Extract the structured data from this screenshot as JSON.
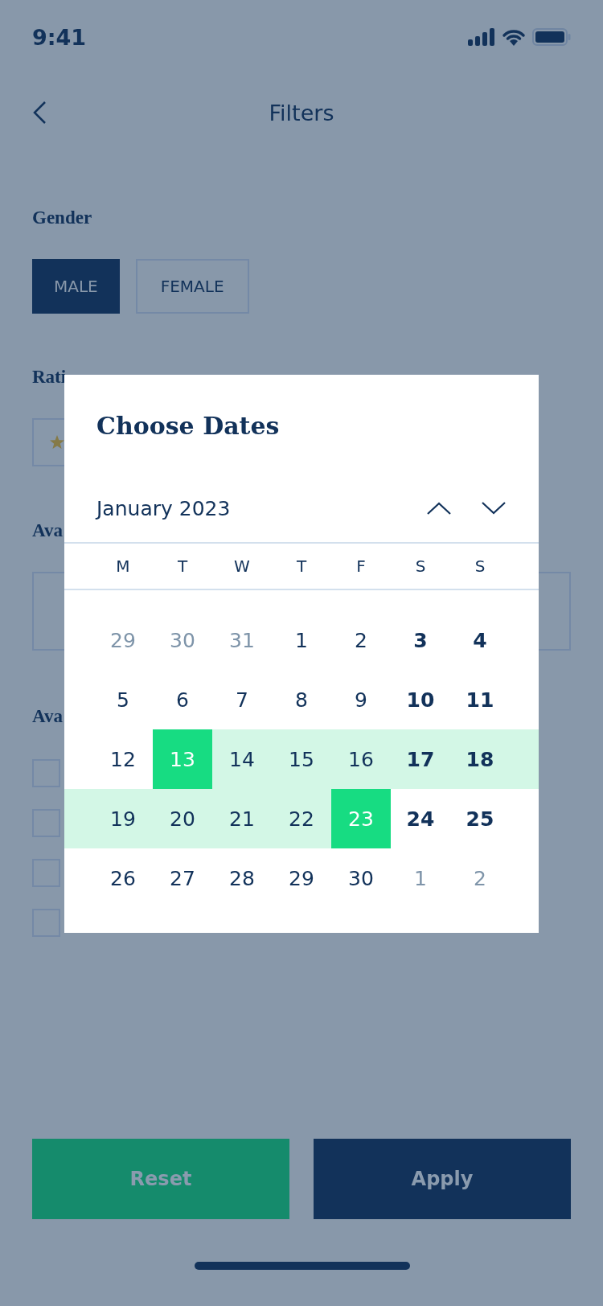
{
  "status_bar": {
    "time": "9:41"
  },
  "header": {
    "title": "Filters"
  },
  "gender": {
    "label": "Gender",
    "options": [
      {
        "label": "MALE",
        "selected": true
      },
      {
        "label": "FEMALE",
        "selected": false
      }
    ]
  },
  "rating": {
    "label": "Rati"
  },
  "availability_dates": {
    "label": "Ava"
  },
  "availability_times": {
    "label": "Ava",
    "checkboxes": [
      {
        "checked": false
      },
      {
        "checked": false
      },
      {
        "checked": false
      },
      {
        "checked": false
      }
    ]
  },
  "date_picker": {
    "title": "Choose Dates",
    "month": "January 2023",
    "weekdays": [
      "M",
      "T",
      "W",
      "T",
      "F",
      "S",
      "S"
    ],
    "weeks": [
      [
        {
          "label": "29",
          "kind": "outside",
          "selected": false,
          "in_range": false
        },
        {
          "label": "30",
          "kind": "outside",
          "selected": false,
          "in_range": false
        },
        {
          "label": "31",
          "kind": "outside",
          "selected": false,
          "in_range": false
        },
        {
          "label": "1",
          "kind": "day",
          "selected": false,
          "in_range": false
        },
        {
          "label": "2",
          "kind": "day",
          "selected": false,
          "in_range": false
        },
        {
          "label": "3",
          "kind": "day",
          "selected": false,
          "in_range": false
        },
        {
          "label": "4",
          "kind": "day",
          "selected": false,
          "in_range": false
        }
      ],
      [
        {
          "label": "5",
          "kind": "day",
          "selected": false,
          "in_range": false
        },
        {
          "label": "6",
          "kind": "day",
          "selected": false,
          "in_range": false
        },
        {
          "label": "7",
          "kind": "day",
          "selected": false,
          "in_range": false
        },
        {
          "label": "8",
          "kind": "day",
          "selected": false,
          "in_range": false
        },
        {
          "label": "9",
          "kind": "day",
          "selected": false,
          "in_range": false
        },
        {
          "label": "10",
          "kind": "day",
          "selected": false,
          "in_range": false
        },
        {
          "label": "11",
          "kind": "day",
          "selected": false,
          "in_range": false
        }
      ],
      [
        {
          "label": "12",
          "kind": "day",
          "selected": false,
          "in_range": false
        },
        {
          "label": "13",
          "kind": "day",
          "selected": true,
          "in_range": true
        },
        {
          "label": "14",
          "kind": "day",
          "selected": false,
          "in_range": true
        },
        {
          "label": "15",
          "kind": "day",
          "selected": false,
          "in_range": true
        },
        {
          "label": "16",
          "kind": "day",
          "selected": false,
          "in_range": true
        },
        {
          "label": "17",
          "kind": "day",
          "selected": false,
          "in_range": true
        },
        {
          "label": "18",
          "kind": "day",
          "selected": false,
          "in_range": true
        }
      ],
      [
        {
          "label": "19",
          "kind": "day",
          "selected": false,
          "in_range": true
        },
        {
          "label": "20",
          "kind": "day",
          "selected": false,
          "in_range": true
        },
        {
          "label": "21",
          "kind": "day",
          "selected": false,
          "in_range": true
        },
        {
          "label": "22",
          "kind": "day",
          "selected": false,
          "in_range": true
        },
        {
          "label": "23",
          "kind": "day",
          "selected": true,
          "in_range": true
        },
        {
          "label": "24",
          "kind": "day",
          "selected": false,
          "in_range": false
        },
        {
          "label": "25",
          "kind": "day",
          "selected": false,
          "in_range": false
        }
      ],
      [
        {
          "label": "26",
          "kind": "day",
          "selected": false,
          "in_range": false
        },
        {
          "label": "27",
          "kind": "day",
          "selected": false,
          "in_range": false
        },
        {
          "label": "28",
          "kind": "day",
          "selected": false,
          "in_range": false
        },
        {
          "label": "29",
          "kind": "day",
          "selected": false,
          "in_range": false
        },
        {
          "label": "30",
          "kind": "day",
          "selected": false,
          "in_range": false
        },
        {
          "label": "1",
          "kind": "outside",
          "selected": false,
          "in_range": false
        },
        {
          "label": "2",
          "kind": "outside",
          "selected": false,
          "in_range": false
        }
      ]
    ]
  },
  "actions": {
    "reset": "Reset",
    "apply": "Apply"
  }
}
